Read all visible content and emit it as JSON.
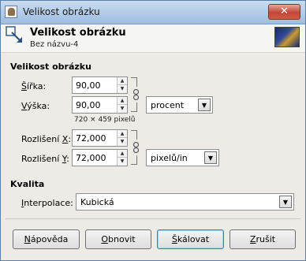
{
  "window": {
    "title": "Velikost obrázku",
    "close_glyph": "✕"
  },
  "header": {
    "title": "Velikost obrázku",
    "subtitle": "Bez názvu-4"
  },
  "image_size": {
    "section_title": "Velikost obrázku",
    "width_label_ul": "Š",
    "width_label_rest": "ířka:",
    "width_value": "90,00",
    "height_label_ul": "V",
    "height_label_rest": "ýška:",
    "height_value": "90,00",
    "unit": "procent",
    "pixel_info": "720 × 459 pixelů"
  },
  "resolution": {
    "x_label_pre": "Rozlišení ",
    "x_label_ul": "X",
    "x_label_post": ":",
    "x_value": "72,000",
    "y_label_pre": "Rozlišení ",
    "y_label_ul": "Y",
    "y_label_post": ":",
    "y_value": "72,000",
    "unit": "pixelů/in"
  },
  "quality": {
    "section_title": "Kvalita",
    "interpolation_label_ul": "I",
    "interpolation_label_rest": "nterpolace:",
    "interpolation_value": "Kubická"
  },
  "buttons": {
    "help_ul": "N",
    "help_rest": "ápověda",
    "reset_ul": "O",
    "reset_rest": "bnovit",
    "scale_ul": "Š",
    "scale_rest": "kálovat",
    "cancel_ul": "Z",
    "cancel_rest": "rušit"
  },
  "icons": {
    "up_arrow": "▲",
    "down_arrow": "▼",
    "dropdown_arrow": "▼"
  },
  "colors": {
    "titlebar": "#9fbde0",
    "close": "#c2463a",
    "dialog_bg": "#ecebe6"
  }
}
